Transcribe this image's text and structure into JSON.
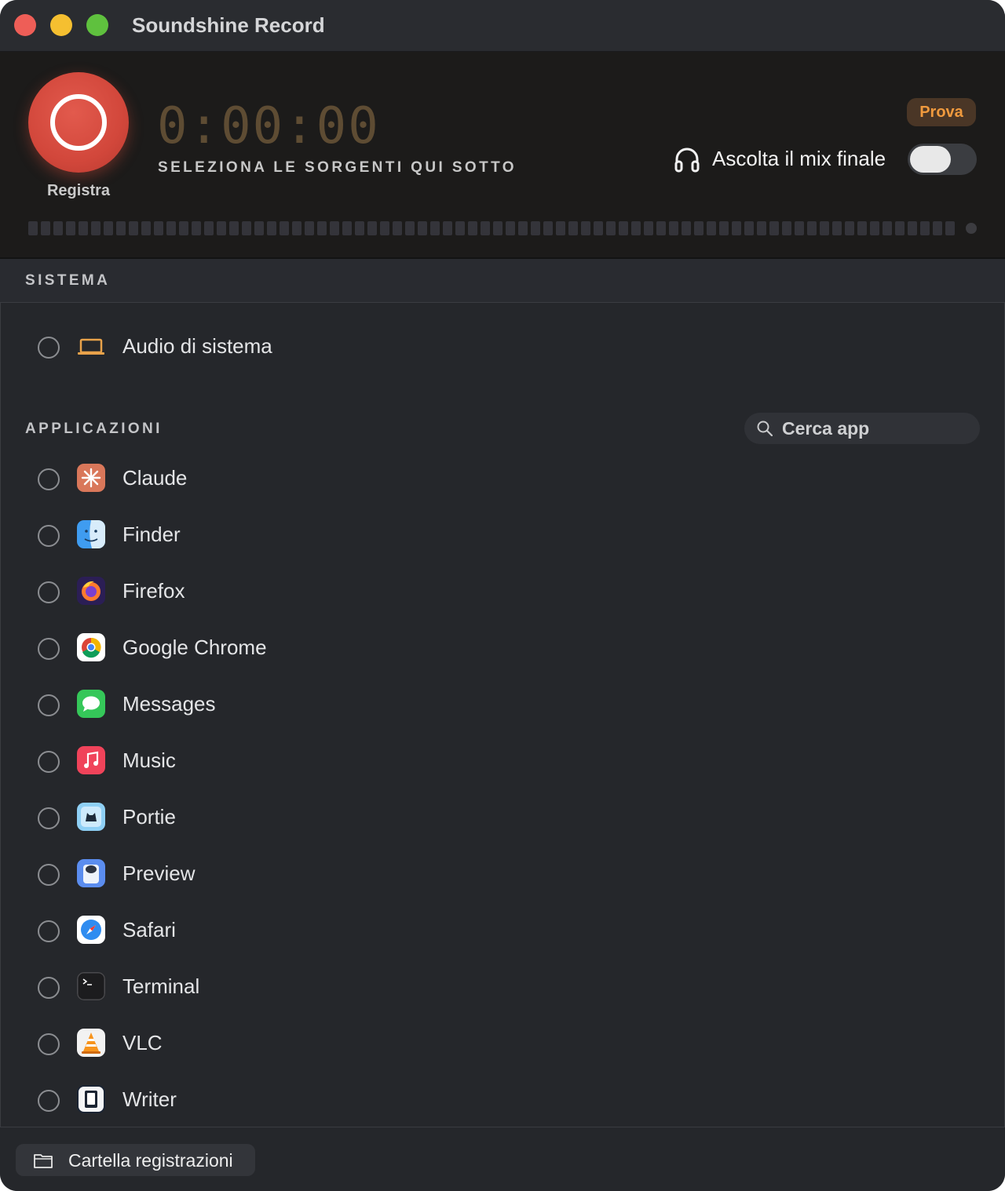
{
  "window": {
    "title": "Soundshine Record"
  },
  "recorder": {
    "record_label": "Registra",
    "timer": "0:00:00",
    "hint": "SELEZIONA LE SORGENTI QUI SOTTO",
    "trial_badge": "Prova",
    "listen_label": "Ascolta il mix finale",
    "listen_enabled": false
  },
  "system_section": {
    "title": "SISTEMA",
    "items": [
      {
        "label": "Audio di sistema",
        "icon": "laptop-icon"
      }
    ]
  },
  "apps_section": {
    "title": "APPLICAZIONI",
    "search_placeholder": "Cerca app",
    "apps": [
      {
        "label": "Claude",
        "icon": "claude-icon"
      },
      {
        "label": "Finder",
        "icon": "finder-icon"
      },
      {
        "label": "Firefox",
        "icon": "firefox-icon"
      },
      {
        "label": "Google Chrome",
        "icon": "chrome-icon"
      },
      {
        "label": "Messages",
        "icon": "messages-icon"
      },
      {
        "label": "Music",
        "icon": "music-icon"
      },
      {
        "label": "Portie",
        "icon": "portie-icon"
      },
      {
        "label": "Preview",
        "icon": "preview-icon"
      },
      {
        "label": "Safari",
        "icon": "safari-icon"
      },
      {
        "label": "Terminal",
        "icon": "terminal-icon"
      },
      {
        "label": "VLC",
        "icon": "vlc-icon"
      },
      {
        "label": "Writer",
        "icon": "writer-icon"
      }
    ]
  },
  "footer": {
    "folder_label": "Cartella registrazioni"
  },
  "colors": {
    "record": "#d94a3e",
    "timer": "#5e4c33",
    "accent_orange": "#f09a3e",
    "background": "#25272b"
  }
}
